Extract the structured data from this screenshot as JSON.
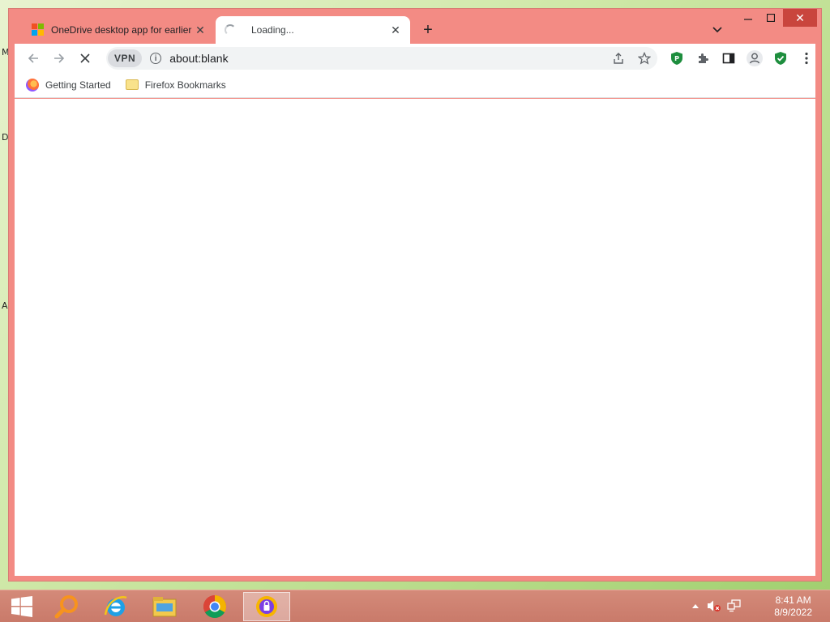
{
  "desktop": {
    "edge_letters": [
      "M",
      "D",
      "A"
    ]
  },
  "browser": {
    "tabs": [
      {
        "title": "OneDrive desktop app for earlier",
        "icon": "microsoft-logo-icon",
        "active": false
      },
      {
        "title": "Loading...",
        "icon": "loading-spinner-icon",
        "active": true
      }
    ],
    "new_tab_label": "+",
    "toolbar": {
      "vpn_label": "VPN",
      "url": "about:blank"
    },
    "bookmarks": [
      {
        "label": "Getting Started",
        "icon": "firefox-icon"
      },
      {
        "label": "Firefox Bookmarks",
        "icon": "folder-icon"
      }
    ]
  },
  "taskbar": {
    "apps": [
      {
        "name": "start-button",
        "icon": "windows-logo-icon"
      },
      {
        "name": "search",
        "icon": "search-magnifier-icon"
      },
      {
        "name": "internet-explorer",
        "icon": "internet-explorer-icon"
      },
      {
        "name": "file-explorer",
        "icon": "file-explorer-icon"
      },
      {
        "name": "chrome",
        "icon": "chrome-icon"
      },
      {
        "name": "vpn-app",
        "icon": "vpn-app-icon",
        "active": true
      }
    ],
    "clock": {
      "time": "8:41 AM",
      "date": "8/9/2022"
    }
  },
  "colors": {
    "window_frame": "#f38b84",
    "close_button": "#c9453d",
    "taskbar": "#c97a6a"
  }
}
